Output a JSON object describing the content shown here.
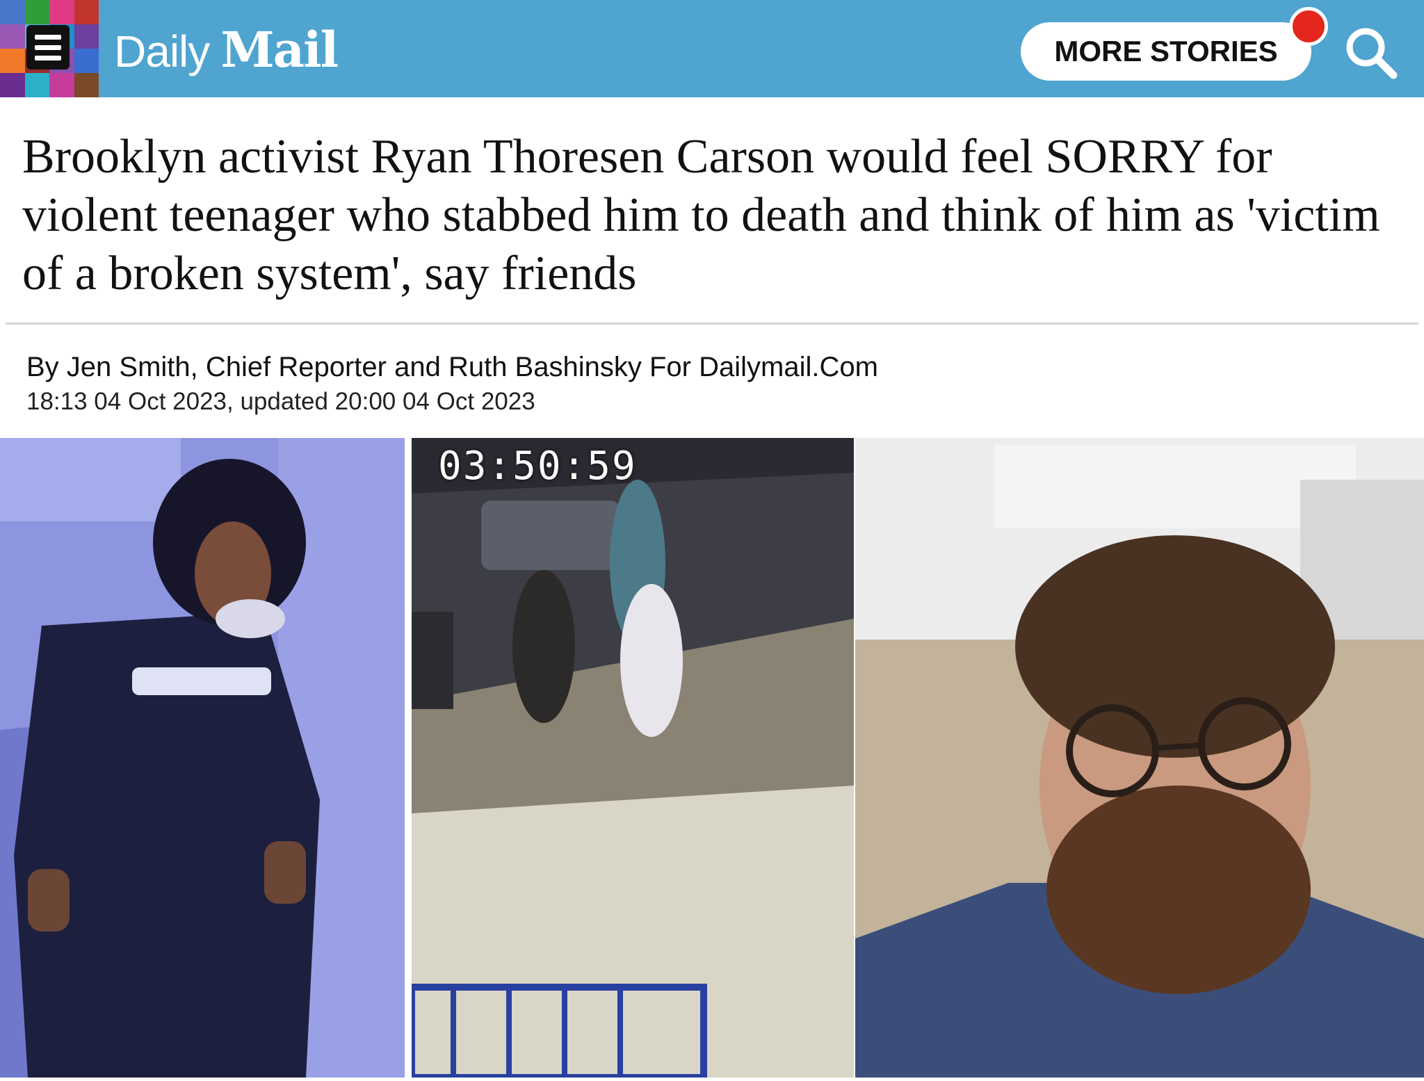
{
  "header": {
    "logo_daily": "Daily",
    "logo_mail": "Mail",
    "more_stories_label": "MORE STORIES",
    "menu_icon": "hamburger-menu-icon",
    "search_icon": "search-icon",
    "background_color": "#4fa4d0",
    "notification_color": "#e3271d",
    "mosaic_colors": [
      "#4a77c9",
      "#2f9e3a",
      "#e03a86",
      "#c2352f",
      "#9b59b6",
      "#5ab0e6",
      "#1e90c8",
      "#6c3fa0",
      "#f07a2a",
      "#9a2b2b",
      "#8a4fb0",
      "#3a6dd0",
      "#6b2d8f",
      "#2ab0c8",
      "#c73b9a",
      "#7a4a28"
    ]
  },
  "article": {
    "headline": "Brooklyn activist Ryan Thoresen Carson would feel SORRY for violent teenager who stabbed him to death and think of him as 'victim of a broken system', say friends",
    "byline": "By Jen Smith, Chief Reporter and Ruth Bashinsky For Dailymail.Com",
    "timestamp": "18:13 04 Oct 2023, updated 20:00 04 Oct 2023"
  },
  "images": {
    "cctv_timestamp": "03:50:59"
  }
}
